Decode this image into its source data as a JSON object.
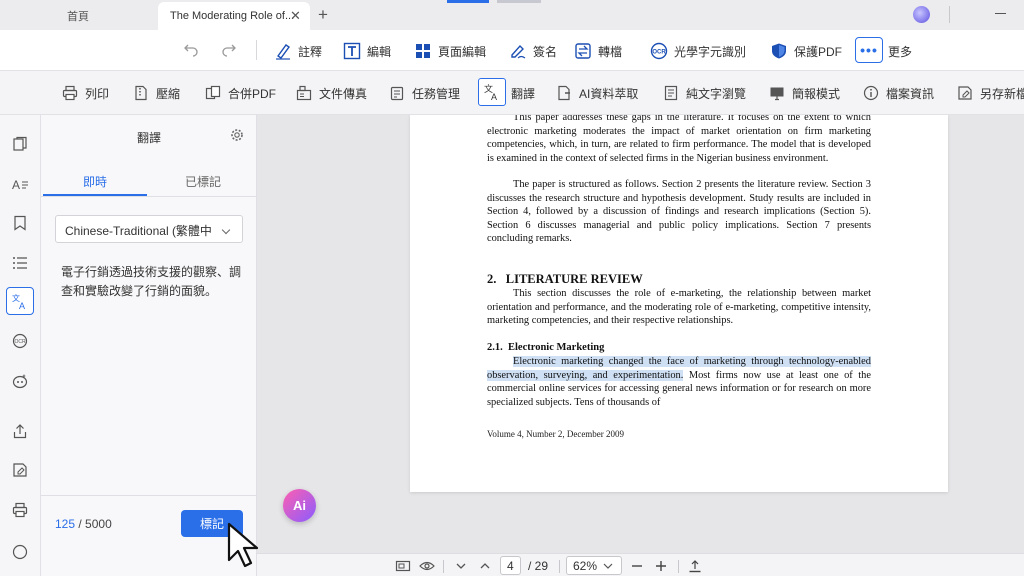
{
  "tabs": [
    {
      "label": "首頁"
    },
    {
      "label": "The Moderating Role of..."
    }
  ],
  "toolbar_main": {
    "items": [
      {
        "label": "註釋"
      },
      {
        "label": "編輯"
      },
      {
        "label": "頁面編輯"
      },
      {
        "label": "簽名"
      },
      {
        "label": "轉檔"
      },
      {
        "label": "光學字元識別"
      },
      {
        "label": "保護PDF"
      },
      {
        "label": "更多"
      }
    ]
  },
  "toolbar_sub": {
    "items": [
      {
        "label": "列印"
      },
      {
        "label": "壓縮"
      },
      {
        "label": "合併PDF"
      },
      {
        "label": "文件傳真"
      },
      {
        "label": "任務管理"
      },
      {
        "label": "翻譯"
      },
      {
        "label": "AI資料萃取"
      },
      {
        "label": "純文字瀏覽"
      },
      {
        "label": "簡報模式"
      },
      {
        "label": "檔案資訊"
      },
      {
        "label": "另存新檔"
      }
    ]
  },
  "translate_panel": {
    "title": "翻譯",
    "tabs": [
      "即時",
      "已標記"
    ],
    "language": "Chinese-Traditional (繁體中",
    "translated_text": "電子行銷透過技術支援的觀察、調查和實驗改變了行銷的面貌。",
    "char_count": "125",
    "char_limit": "/ 5000",
    "mark_button": "標記"
  },
  "document": {
    "para1": "This paper addresses these gaps in the literature. It focuses on the extent to which electronic marketing moderates the impact of market orientation on firm marketing competencies, which, in turn, are related to firm performance. The model that is developed is examined in the context of selected firms in the Nigerian business environment.",
    "para2": "The paper is structured as follows. Section 2 presents the literature review. Section 3 discusses the research structure and hypothesis development. Study results are included in Section 4, followed by a discussion of findings and research implications (Section 5). Section 6 discusses managerial and public policy implications. Section 7 presents concluding remarks.",
    "heading2": "2.   LITERATURE REVIEW",
    "para3": "This section discusses the role of e-marketing, the relationship between market orientation and performance, and the moderating role of e-marketing, competitive intensity, marketing competencies, and their respective relationships.",
    "heading21": "2.1.  Electronic Marketing",
    "highlighted": "Electronic marketing changed the face of marketing through technology-enabled observation, surveying, and experimentation.",
    "para4_rest": " Most firms now use at least one of the commercial online services for accessing general news information or for research on more specialized subjects.  Tens of thousands of",
    "footer": "Volume 4, Number 2, December 2009"
  },
  "ai_button": "Ai",
  "statusbar": {
    "page_current": "4",
    "page_total": "/ 29",
    "zoom": "62%"
  }
}
